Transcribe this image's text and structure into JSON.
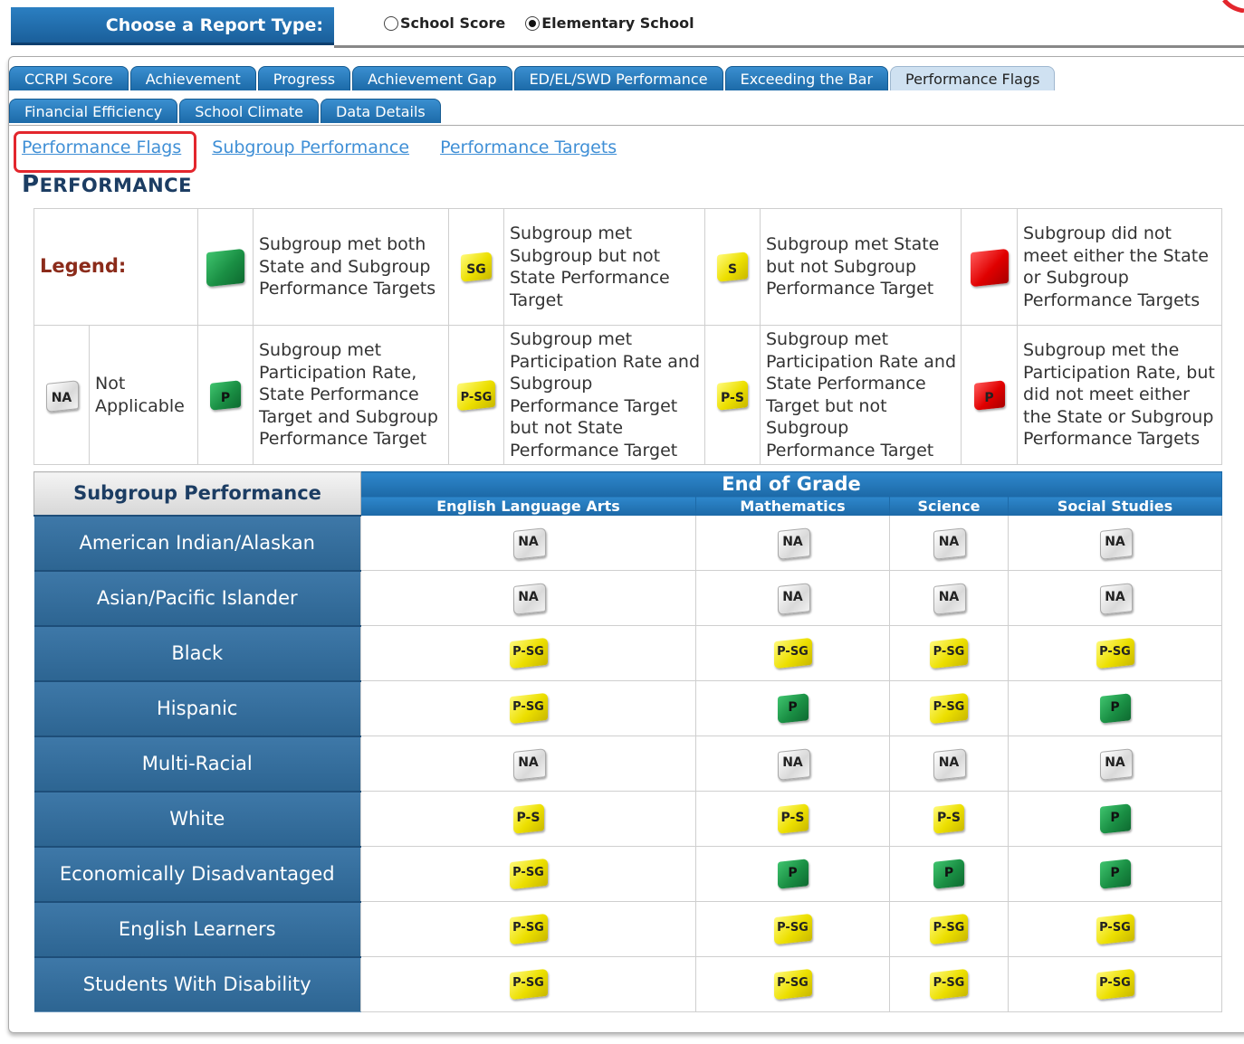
{
  "report_type": {
    "label": "Choose a Report Type:",
    "options": [
      {
        "label": "School Score",
        "selected": false
      },
      {
        "label": "Elementary School",
        "selected": true
      }
    ]
  },
  "tabs": {
    "row1": [
      "CCRPI Score",
      "Achievement",
      "Progress",
      "Achievement Gap",
      "ED/EL/SWD Performance",
      "Exceeding the Bar",
      "Performance Flags"
    ],
    "row2": [
      "Financial Efficiency",
      "School Climate",
      "Data Details"
    ],
    "active": "Performance Flags"
  },
  "sub_links": [
    "Performance Flags",
    "Subgroup Performance",
    "Performance Targets"
  ],
  "section_title": {
    "first": "P",
    "rest": "ERFORMANCE"
  },
  "legend": {
    "label": "Legend:",
    "row1": [
      {
        "flag": "green",
        "code": "",
        "text": "Subgroup met both State and Subgroup Performance Targets"
      },
      {
        "flag": "yellow",
        "code": "SG",
        "text": "Subgroup met Subgroup but not State Performance Target"
      },
      {
        "flag": "yellow",
        "code": "S",
        "text": "Subgroup met State but not Subgroup Performance Target"
      },
      {
        "flag": "red",
        "code": "",
        "text": "Subgroup did not meet either the State or Subgroup Performance Targets"
      }
    ],
    "na": {
      "code": "NA",
      "text": "Not Applicable"
    },
    "row2": [
      {
        "flag": "green",
        "code": "P",
        "text": "Subgroup met Participation Rate, State Performance Target and Subgroup Performance Target"
      },
      {
        "flag": "yellow",
        "code": "P-SG",
        "text": "Subgroup met Participation Rate and Subgroup Performance Target but not State Performance Target"
      },
      {
        "flag": "yellow",
        "code": "P-S",
        "text": "Subgroup met Participation Rate and State Performance Target but not Subgroup Performance Target"
      },
      {
        "flag": "red",
        "code": "P",
        "text": "Subgroup met the Participation Rate, but did not meet either the State or Subgroup Performance Targets"
      }
    ]
  },
  "performance_table": {
    "row_header": "Subgroup Performance",
    "group_header": "End of Grade",
    "subjects": [
      "English Language Arts",
      "Mathematics",
      "Science",
      "Social Studies"
    ],
    "rows": [
      {
        "subgroup": "American Indian/Alaskan",
        "flags": [
          "NA",
          "NA",
          "NA",
          "NA"
        ]
      },
      {
        "subgroup": "Asian/Pacific Islander",
        "flags": [
          "NA",
          "NA",
          "NA",
          "NA"
        ]
      },
      {
        "subgroup": "Black",
        "flags": [
          "P-SG",
          "P-SG",
          "P-SG",
          "P-SG"
        ]
      },
      {
        "subgroup": "Hispanic",
        "flags": [
          "P-SG",
          "P",
          "P-SG",
          "P"
        ]
      },
      {
        "subgroup": "Multi-Racial",
        "flags": [
          "NA",
          "NA",
          "NA",
          "NA"
        ]
      },
      {
        "subgroup": "White",
        "flags": [
          "P-S",
          "P-S",
          "P-S",
          "P"
        ]
      },
      {
        "subgroup": "Economically Disadvantaged",
        "flags": [
          "P-SG",
          "P",
          "P",
          "P"
        ]
      },
      {
        "subgroup": "English Learners",
        "flags": [
          "P-SG",
          "P-SG",
          "P-SG",
          "P-SG"
        ]
      },
      {
        "subgroup": "Students With Disability",
        "flags": [
          "P-SG",
          "P-SG",
          "P-SG",
          "P-SG"
        ]
      }
    ]
  },
  "colors": {
    "header_blue": "#1d6aa8",
    "row_blue": "#336c9a",
    "highlight_red": "#e3262d",
    "link_blue": "#3f8fd6",
    "legend_label": "#8b2b1a"
  }
}
